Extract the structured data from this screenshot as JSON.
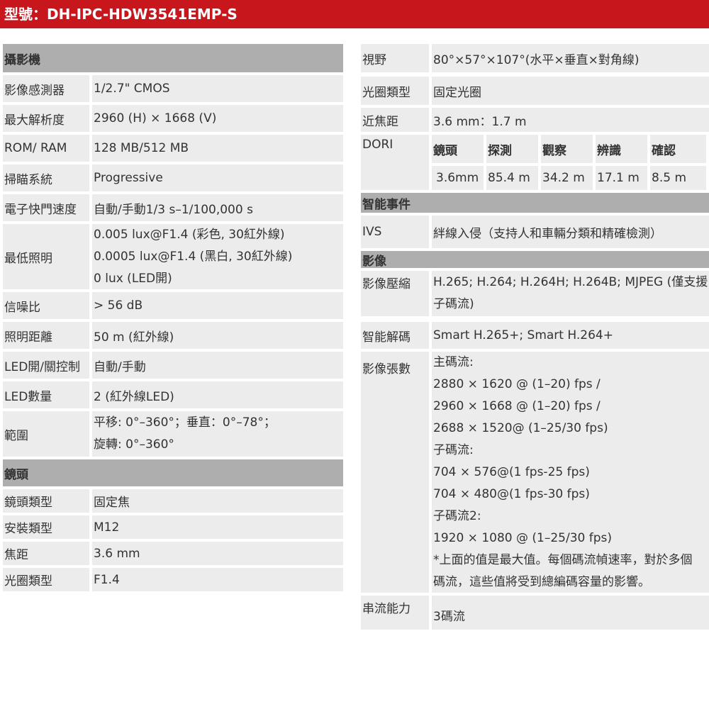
{
  "header": {
    "title": "型號：DH-IPC-HDW3541EMP-S"
  },
  "left": {
    "camera_section": "攝影機",
    "camera_rows": [
      {
        "label": "影像感測器",
        "lines": [
          "1/2.7\" CMOS"
        ]
      },
      {
        "label": "最大解析度",
        "lines": [
          "2960 (H) × 1668 (V)"
        ]
      },
      {
        "label": "ROM/ RAM",
        "lines": [
          "128 MB/512 MB"
        ]
      },
      {
        "label": "掃瞄系統",
        "lines": [
          "Progressive"
        ]
      },
      {
        "label": "電子快門速度",
        "lines": [
          "自動/手動1/3 s–1/100,000 s"
        ]
      },
      {
        "label": "最低照明",
        "lines": [
          "0.005 lux@F1.4 (彩色, 30紅外線)",
          "0.0005 lux@F1.4 (黑白, 30紅外線)",
          "0 lux (LED開)"
        ]
      },
      {
        "label": "信噪比",
        "lines": [
          "> 56 dB"
        ]
      },
      {
        "label": "照明距離",
        "lines": [
          "50 m (紅外線)"
        ]
      },
      {
        "label": "LED開/關控制",
        "lines": [
          "自動/手動"
        ]
      },
      {
        "label": "LED數量",
        "lines": [
          "2 (紅外線LED)"
        ]
      },
      {
        "label": "範圍",
        "lines": [
          "平移: 0°–360°；垂直：0°–78°；",
          "旋轉: 0°–360°"
        ]
      }
    ],
    "lens_section": "鏡頭",
    "lens_rows": [
      {
        "label": "鏡頭類型",
        "lines": [
          "固定焦"
        ]
      },
      {
        "label": "安裝類型",
        "lines": [
          "M12"
        ]
      },
      {
        "label": "焦距",
        "lines": [
          "3.6 mm"
        ]
      },
      {
        "label": "光圈類型",
        "lines": [
          "F1.4"
        ]
      }
    ]
  },
  "right": {
    "fov": {
      "label": "視野",
      "value": "80°×57°×107°(水平×垂直×對角線)"
    },
    "iris": {
      "label": "光圈類型",
      "value": "固定光圈"
    },
    "close_focus": {
      "label": "近焦距",
      "value": "3.6 mm：1.7 m"
    },
    "dori": {
      "label": "DORI",
      "headers": [
        "鏡頭",
        "探測",
        "觀察",
        "辨識",
        "確認"
      ],
      "values": [
        "3.6mm",
        "85.4 m",
        "34.2 m",
        "17.1 m",
        "8.5 m"
      ]
    },
    "smart_section": "智能事件",
    "ivs": {
      "label": "IVS",
      "value": "絆線入侵（支持人和車輛分類和精確檢測）"
    },
    "video_section": "影像",
    "compression": {
      "label": "影像壓縮",
      "lines": [
        "H.265; H.264; H.264H; H.264B; MJPEG (僅支援",
        "子碼流)"
      ]
    },
    "smart_codec": {
      "label": "智能解碼",
      "value": "Smart H.265+; Smart H.264+"
    },
    "frame_rate": {
      "label": "影像張數",
      "lines": [
        "主碼流:",
        "2880 × 1620 @ (1–20) fps /",
        "2960 × 1668 @ (1–20) fps /",
        "2688 × 1520@ (1–25/30 fps)",
        "子碼流:",
        "704 × 576@(1 fps-25 fps)",
        "704 × 480@(1 fps-30 fps)",
        "子碼流2:",
        "1920 × 1080 @ (1–25/30 fps)",
        "*上面的值是最大值。每個碼流幀速率，對於多個",
        "碼流，這些值將受到總編碼容量的影響。"
      ]
    },
    "stream": {
      "label": "串流能力",
      "value": "3碼流"
    }
  }
}
